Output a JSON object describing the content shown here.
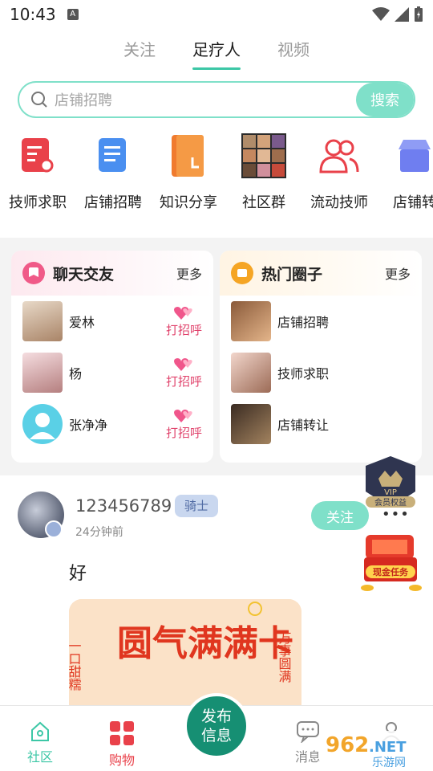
{
  "status": {
    "time": "10:43",
    "notif": "A"
  },
  "tabs": [
    {
      "label": "关注"
    },
    {
      "label": "足疗人"
    },
    {
      "label": "视频"
    }
  ],
  "search": {
    "placeholder": "店铺招聘",
    "button": "搜索"
  },
  "categories": [
    {
      "label": "技师求职",
      "icon": "resume-icon",
      "color": "#e9414a"
    },
    {
      "label": "店铺招聘",
      "icon": "document-icon",
      "color": "#4a8ff0"
    },
    {
      "label": "知识分享",
      "icon": "book-icon",
      "color": "#f07b2f"
    },
    {
      "label": "社区群",
      "icon": "group-photo-icon",
      "color": "#444"
    },
    {
      "label": "流动技师",
      "icon": "people-icon",
      "color": "#e9414a"
    },
    {
      "label": "店铺转",
      "icon": "shop-icon",
      "color": "#6f7ef0"
    }
  ],
  "chat_card": {
    "title": "聊天交友",
    "more": "更多",
    "people": [
      {
        "name": "爱林",
        "action": "打招呼"
      },
      {
        "name": "杨",
        "action": "打招呼"
      },
      {
        "name": "张净净",
        "action": "打招呼"
      }
    ]
  },
  "circle_card": {
    "title": "热门圈子",
    "more": "更多",
    "circles": [
      {
        "name": "店铺招聘"
      },
      {
        "name": "技师求职"
      },
      {
        "name": "店铺转让"
      }
    ]
  },
  "post": {
    "username": "123456789",
    "rank": "骑士",
    "time": "24分钟前",
    "follow": "关注",
    "text": "好",
    "image_text": "圆气满满卡",
    "image_side_left": "一口甜糯",
    "image_side_right": "万事圆满"
  },
  "floating": {
    "vip_label": "会员权益",
    "vip": "VIP",
    "more_dots": "•••",
    "task_label": "现金任务"
  },
  "nav": {
    "community": "社区",
    "shop": "购物",
    "publish_line1": "发布",
    "publish_line2": "信息",
    "messages": "消息",
    "watermark": "962.NET 乐游网"
  },
  "colors": {
    "accent": "#7fe0c9",
    "accent_dark": "#168f73",
    "pink": "#e0426b"
  }
}
